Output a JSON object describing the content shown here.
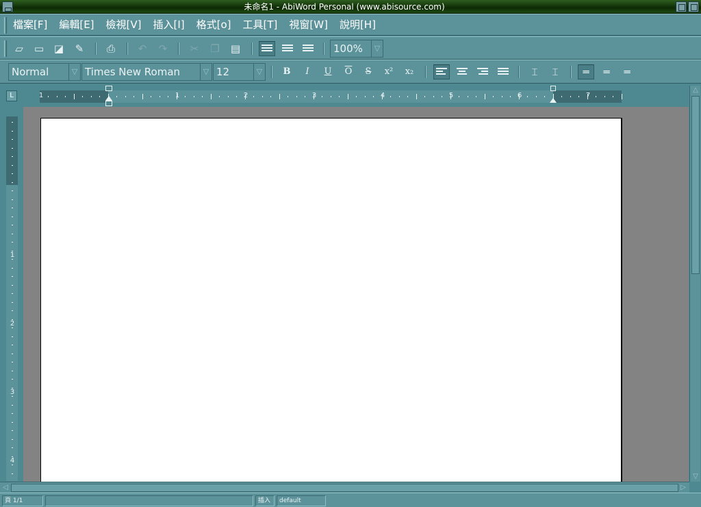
{
  "window": {
    "title": "未命名1 - AbiWord Personal (www.abisource.com)"
  },
  "menu": [
    "檔案[F]",
    "編輯[E]",
    "檢視[V]",
    "插入[I]",
    "格式[o]",
    "工具[T]",
    "視窗[W]",
    "說明[H]"
  ],
  "toolbar": {
    "zoom": "100%",
    "icons": [
      "new-document-icon",
      "open-folder-icon",
      "save-icon",
      "save-as-icon",
      "print-icon",
      "undo-icon",
      "redo-icon",
      "cut-icon",
      "copy-icon",
      "paste-icon",
      "view-normal-icon",
      "view-web-icon",
      "view-print-icon"
    ]
  },
  "format": {
    "style": "Normal",
    "font": "Times New Roman",
    "size": "12",
    "bold": "B",
    "italic": "I",
    "underline": "U",
    "overline": "O",
    "strike": "S",
    "superscript": "x²",
    "subscript": "x₂"
  },
  "ruler": {
    "h_numbers": [
      "1",
      "1",
      "2",
      "3",
      "4",
      "5",
      "6",
      "7"
    ],
    "v_numbers": [
      "1",
      "2",
      "3",
      "4"
    ]
  },
  "status": {
    "page": "頁 1/1",
    "mode": "插入",
    "lang": "default"
  },
  "colors": {
    "chrome": "#5c929a",
    "titlebar": "#0d2a05",
    "canvas": "#838383",
    "page": "#ffffff"
  }
}
